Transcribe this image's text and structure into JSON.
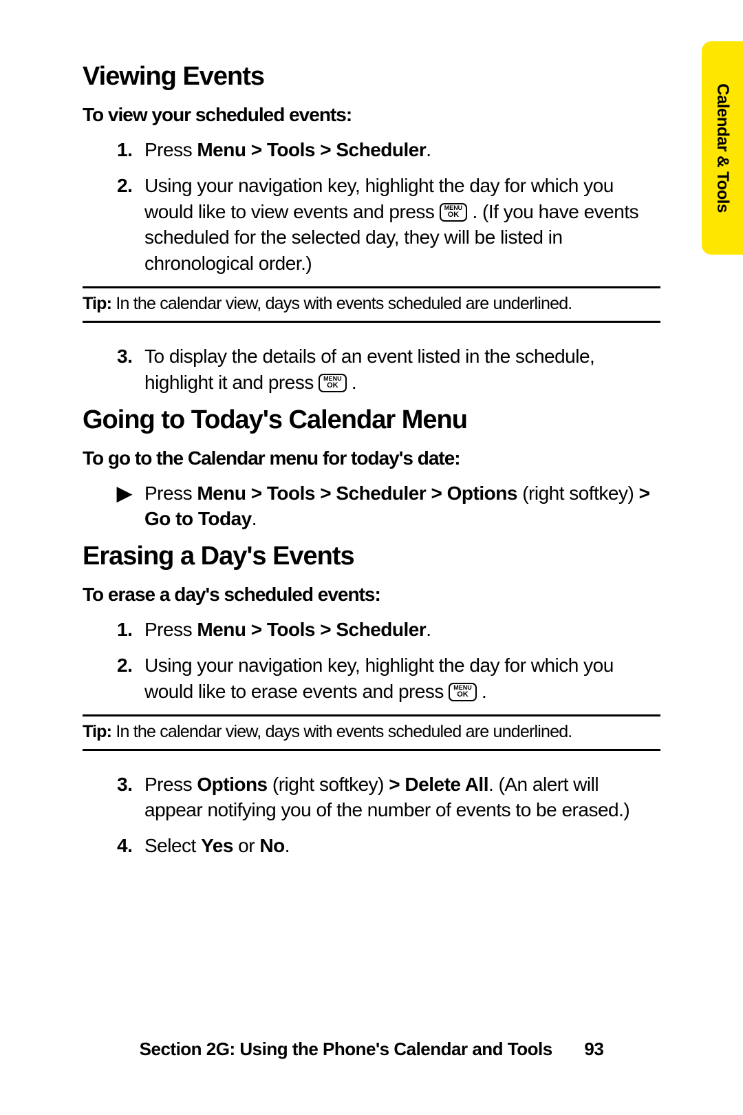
{
  "tab": {
    "label": "Calendar & Tools"
  },
  "key": {
    "line1": "MENU",
    "line2": "OK"
  },
  "s1": {
    "title": "Viewing Events",
    "intro": "To view your scheduled events:",
    "step1_num": "1.",
    "step1_a": "Press ",
    "step1_b": "Menu > Tools > Scheduler",
    "step1_c": ".",
    "step2_num": "2.",
    "step2_a": "Using your navigation key, highlight the day for which you would like to view events and press ",
    "step2_b": " . (If you have events scheduled for the selected day, they will be listed in chronological order.)",
    "tip_label": "Tip: ",
    "tip_text": "In the calendar view, days with events scheduled are underlined.",
    "step3_num": "3.",
    "step3_a": "To display the details of an event listed in the schedule, highlight it and press ",
    "step3_b": " ."
  },
  "s2": {
    "title": "Going to Today's Calendar Menu",
    "intro": "To go to the Calendar menu for today's date:",
    "arrow": "▶",
    "a": "Press ",
    "b": "Menu > Tools > Scheduler > Options",
    "c": " (right softkey) ",
    "d": "> Go to Today",
    "e": "."
  },
  "s3": {
    "title": "Erasing a Day's Events",
    "intro": "To erase a day's scheduled events:",
    "step1_num": "1.",
    "step1_a": "Press ",
    "step1_b": "Menu > Tools > Scheduler",
    "step1_c": ".",
    "step2_num": "2.",
    "step2_a": "Using your navigation key, highlight the day for which you would like to erase events and press ",
    "step2_b": " .",
    "tip_label": "Tip: ",
    "tip_text": "In the calendar view, days with events scheduled are underlined.",
    "step3_num": "3.",
    "step3_a": "Press ",
    "step3_b": "Options",
    "step3_c": " (right softkey) ",
    "step3_d": "> Delete All",
    "step3_e": ". (An alert will appear notifying you of the number of events to be erased.)",
    "step4_num": "4.",
    "step4_a": "Select ",
    "step4_b": "Yes",
    "step4_c": " or ",
    "step4_d": "No",
    "step4_e": "."
  },
  "footer": {
    "text": "Section 2G: Using the Phone's Calendar and Tools",
    "page": "93"
  }
}
